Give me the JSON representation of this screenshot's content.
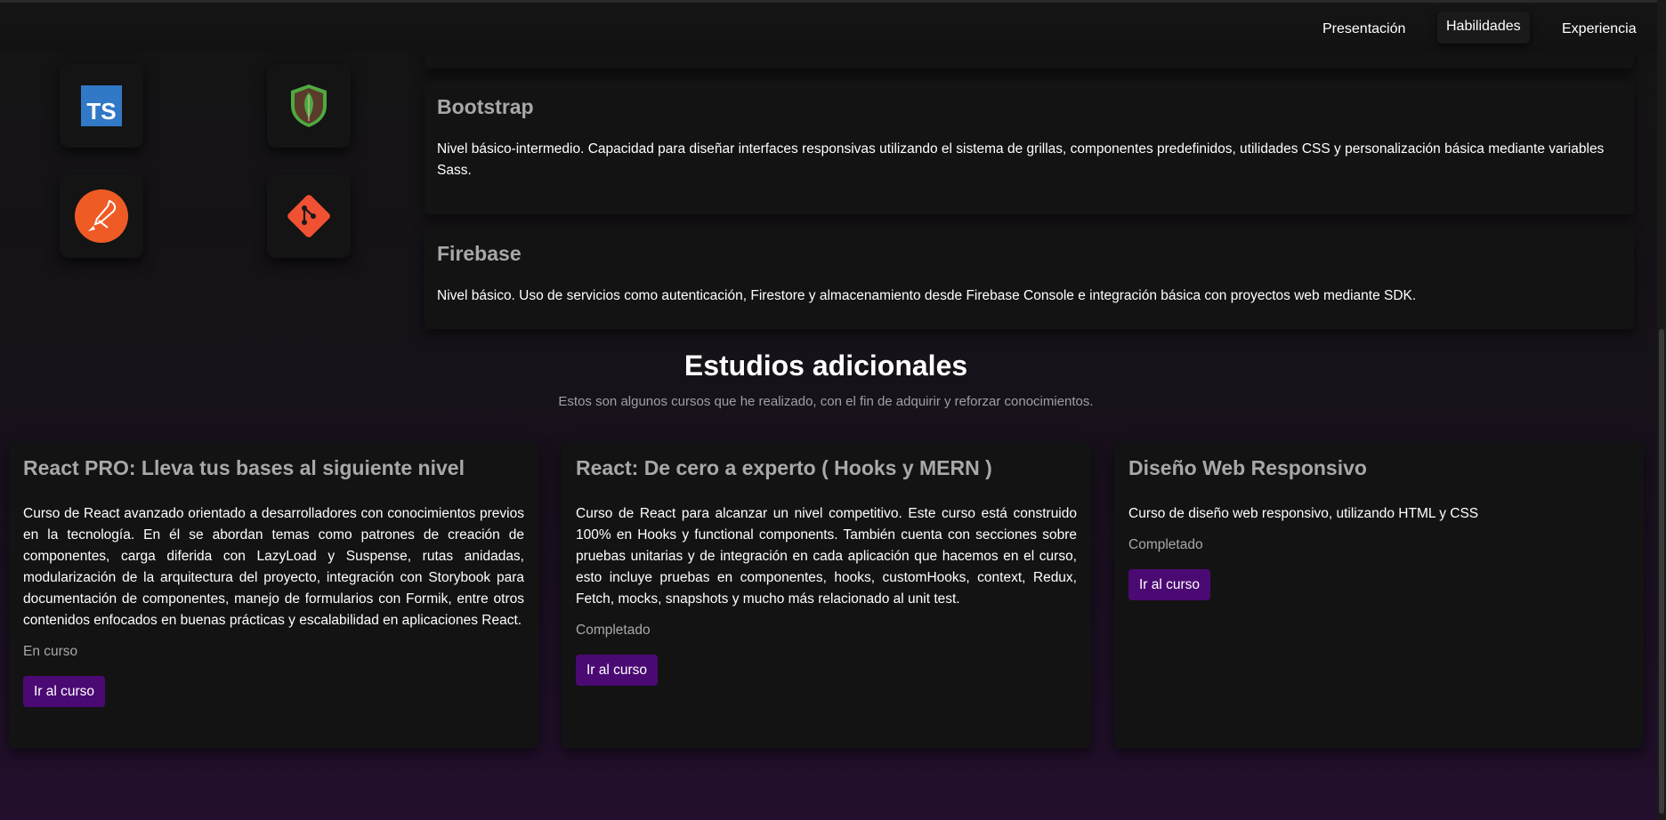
{
  "nav": {
    "items": [
      {
        "label": "Presentación"
      },
      {
        "label": "Habilidades"
      },
      {
        "label": "Experiencia"
      }
    ],
    "active": "Habilidades"
  },
  "icons": [
    {
      "name": "typescript-icon",
      "label": "TS",
      "color": "#3178c6"
    },
    {
      "name": "mongodb-icon",
      "color": "#4faa41"
    },
    {
      "name": "postman-icon",
      "color": "#ef5b25"
    },
    {
      "name": "git-icon",
      "color": "#f05133"
    }
  ],
  "skills": [
    {
      "title": "Bootstrap",
      "description": "Nivel básico-intermedio. Capacidad para diseñar interfaces responsivas utilizando el sistema de grillas, componentes predefinidos, utilidades CSS y personalización básica mediante variables Sass."
    },
    {
      "title": "Firebase",
      "description": "Nivel básico. Uso de servicios como autenticación, Firestore y almacenamiento desde Firebase Console e integración básica con proyectos web mediante SDK."
    }
  ],
  "section": {
    "title": "Estudios adicionales",
    "subtitle": "Estos son algunos cursos que he realizado, con el fin de adquirir y reforzar conocimientos."
  },
  "courses": [
    {
      "title": "React PRO: Lleva tus bases al siguiente nivel",
      "description": "Curso de React avanzado orientado a desarrolladores con conocimientos previos en la tecnología. En él se abordan temas como patrones de creación de componentes, carga diferida con LazyLoad y Suspense, rutas anidadas, modularización de la arquitectura del proyecto, integración con Storybook para documentación de componentes, manejo de formularios con Formik, entre otros contenidos enfocados en buenas prácticas y escalabilidad en aplicaciones React.",
      "status": "En curso",
      "button": "Ir al curso"
    },
    {
      "title": "React: De cero a experto ( Hooks y MERN )",
      "description": "Curso de React para alcanzar un nivel competitivo. Este curso está construido 100% en Hooks y functional components. También cuenta con secciones sobre pruebas unitarias y de integración en cada aplicación que hacemos en el curso, esto incluye pruebas en componentes, hooks, customHooks, context, Redux, Fetch, mocks, snapshots y mucho más relacionado al unit test.",
      "status": "Completado",
      "button": "Ir al curso"
    },
    {
      "title": "Diseño Web Responsivo",
      "description": "Curso de diseño web responsivo, utilizando HTML y CSS",
      "status": "Completado",
      "button": "Ir al curso"
    }
  ],
  "colors": {
    "accent": "#4b0a73",
    "muted_text": "#a8a8a8",
    "card_bg": "#131313"
  }
}
